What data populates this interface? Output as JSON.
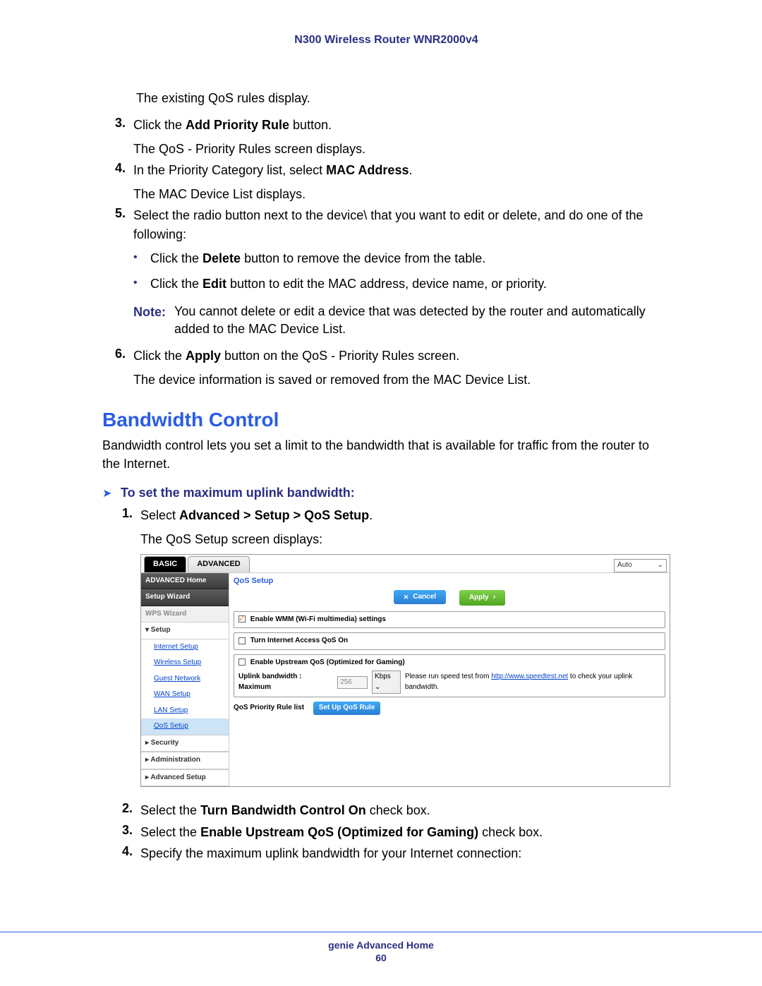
{
  "header": {
    "title": "N300 Wireless Router WNR2000v4"
  },
  "content": {
    "intro_pre": "The existing QoS rules display.",
    "step3_num": "3.",
    "step3_a": "Click the ",
    "step3_b": "Add Priority Rule",
    "step3_c": " button.",
    "step3_after": "The QoS - Priority Rules screen displays.",
    "step4_num": "4.",
    "step4_a": "In the Priority Category list, select ",
    "step4_b": "MAC Address",
    "step4_c": ".",
    "step4_after": "The MAC Device List displays.",
    "step5_num": "5.",
    "step5_text": "Select the radio button next to the device\\ that you want to edit or delete, and do one of the following:",
    "step5_b1_a": "Click the ",
    "step5_b1_b": "Delete",
    "step5_b1_c": " button to remove the device from the table.",
    "step5_b2_a": "Click the ",
    "step5_b2_b": "Edit",
    "step5_b2_c": " button to edit the MAC address, device name, or priority.",
    "note_label": "Note:",
    "note_text": "You cannot delete or edit a device that was detected by the router and automatically added to the MAC Device List.",
    "step6_num": "6.",
    "step6_a": "Click the ",
    "step6_b": "Apply",
    "step6_c": " button on the QoS - Priority Rules screen.",
    "step6_after": "The device information is saved or removed from the MAC Device List.",
    "section_heading": "Bandwidth Control",
    "section_intro": "Bandwidth control lets you set a limit to the bandwidth that is available for traffic from the router to the Internet.",
    "task_title": "To set the maximum uplink bandwidth:",
    "t_step1_num": "1.",
    "t_step1_a": "Select ",
    "t_step1_b": "Advanced > Setup > QoS Setup",
    "t_step1_c": ".",
    "t_step1_after": "The QoS Setup screen displays:",
    "t_step2_num": "2.",
    "t_step2_a": "Select the ",
    "t_step2_b": "Turn Bandwidth Control On",
    "t_step2_c": " check box.",
    "t_step3_num": "3.",
    "t_step3_a": "Select the ",
    "t_step3_b": "Enable Upstream QoS (Optimized for Gaming)",
    "t_step3_c": " check box.",
    "t_step4_num": "4.",
    "t_step4_text": "Specify the maximum uplink bandwidth for your Internet connection:"
  },
  "screenshot": {
    "tab_basic": "BASIC",
    "tab_advanced": "ADVANCED",
    "auto": "Auto",
    "nav": {
      "adv_home": "ADVANCED Home",
      "setup_wizard": "Setup Wizard",
      "wps_wizard": "WPS Wizard",
      "setup": "▾ Setup",
      "internet": "Internet Setup",
      "wireless": "Wireless Setup",
      "guest": "Guest Network",
      "wan": "WAN Setup",
      "lan": "LAN Setup",
      "qos": "QoS Setup",
      "security": "▸ Security",
      "admin": "▸ Administration",
      "advsetup": "▸ Advanced Setup"
    },
    "main": {
      "title": "QoS Setup",
      "cancel": "Cancel",
      "apply": "Apply",
      "enable_wmm": "Enable WMM (Wi-Fi multimedia) settings",
      "turn_qos_on": "Turn Internet Access QoS On",
      "enable_upstream": "Enable Upstream QoS (Optimized for Gaming)",
      "uplink_label": "Uplink bandwidth :   Maximum",
      "uplink_value": "256",
      "uplink_unit": "Kbps",
      "speedtest_pre": "Please run speed test from ",
      "speedtest_link": "http://www.speedtest.net",
      "speedtest_post": " to check your uplink bandwidth.",
      "rule_list": "QoS Priority Rule list",
      "rule_btn": "Set Up QoS Rule"
    }
  },
  "footer": {
    "title": "genie Advanced Home",
    "page": "60"
  }
}
